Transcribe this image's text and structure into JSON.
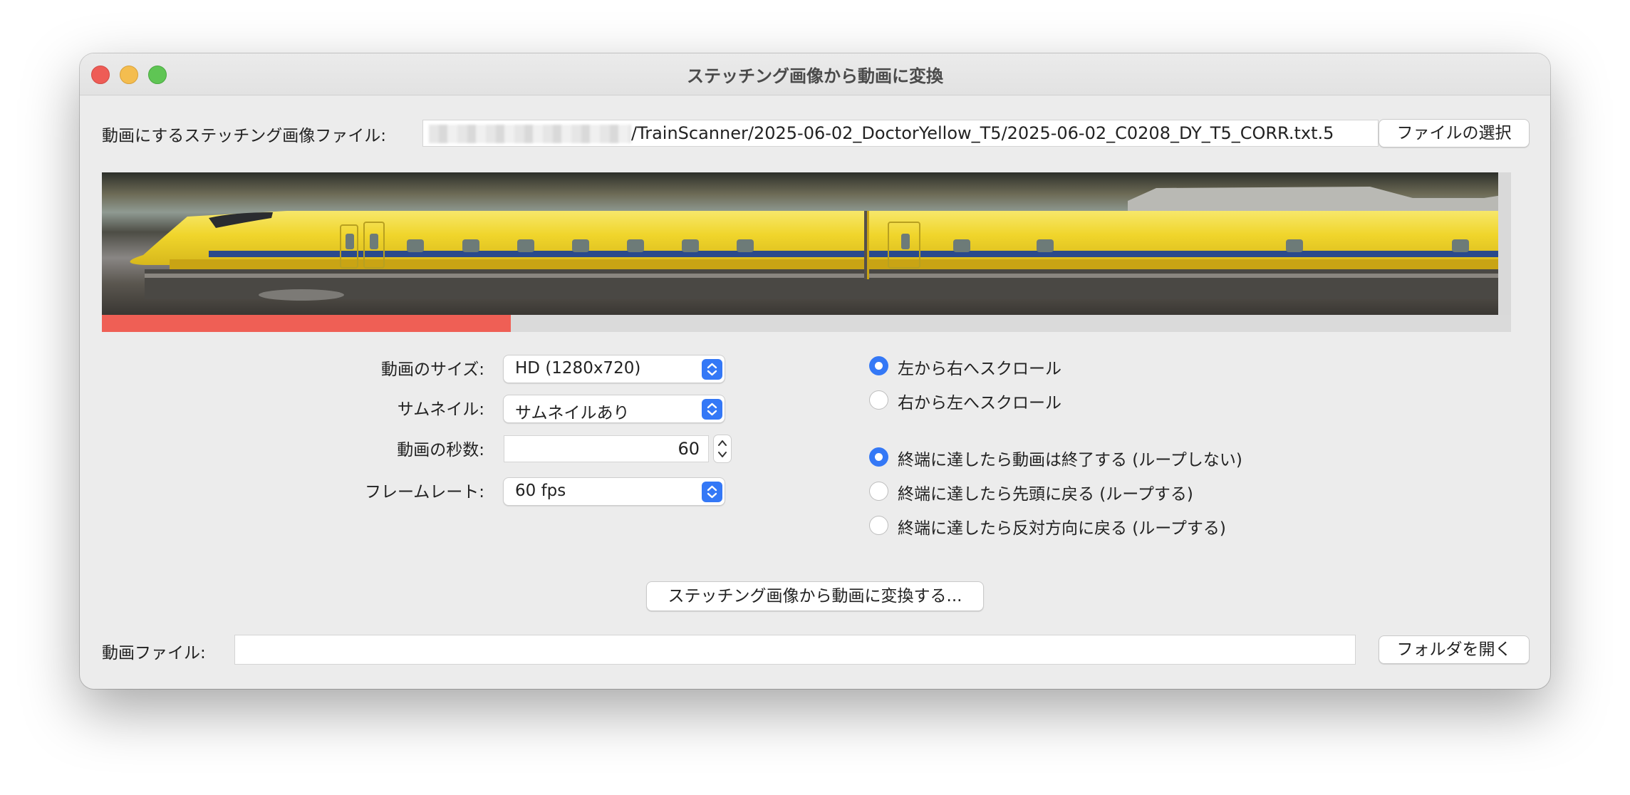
{
  "window": {
    "title": "ステッチング画像から動画に変換"
  },
  "source": {
    "label": "動画にするステッチング画像ファイル:",
    "path_visible": "/TrainScanner/2025-06-02_DoctorYellow_T5/2025-06-02_C0208_DY_T5_CORR.txt.5",
    "choose_button": "ファイルの選択"
  },
  "progress": {
    "fraction": 0.29
  },
  "settings": {
    "size_label": "動画のサイズ:",
    "size_value": "HD (1280x720)",
    "thumb_label": "サムネイル:",
    "thumb_value": "サムネイルあり",
    "seconds_label": "動画の秒数:",
    "seconds_value": "60",
    "fps_label": "フレームレート:",
    "fps_value": "60 fps"
  },
  "scroll": {
    "options": [
      "左から右へスクロール",
      "右から左へスクロール"
    ],
    "selected": 0
  },
  "loop": {
    "options": [
      "終端に達したら動画は終了する (ループしない)",
      "終端に達したら先頭に戻る (ループする)",
      "終端に達したら反対方向に戻る (ループする)"
    ],
    "selected": 0
  },
  "convert_button": "ステッチング画像から動画に変換する...",
  "output": {
    "label": "動画ファイル:",
    "value": "",
    "open_folder_button": "フォルダを開く"
  },
  "colors": {
    "accent": "#3478f6",
    "progress": "#ef5f55",
    "train_yellow": "#f2d531",
    "train_stripe": "#2a4a8c"
  },
  "icons": {
    "window_close": "close-icon",
    "window_minimize": "minimize-icon",
    "window_zoom": "zoom-icon",
    "popup": "chevron-updown-icon",
    "stepper": "stepper-icon"
  }
}
